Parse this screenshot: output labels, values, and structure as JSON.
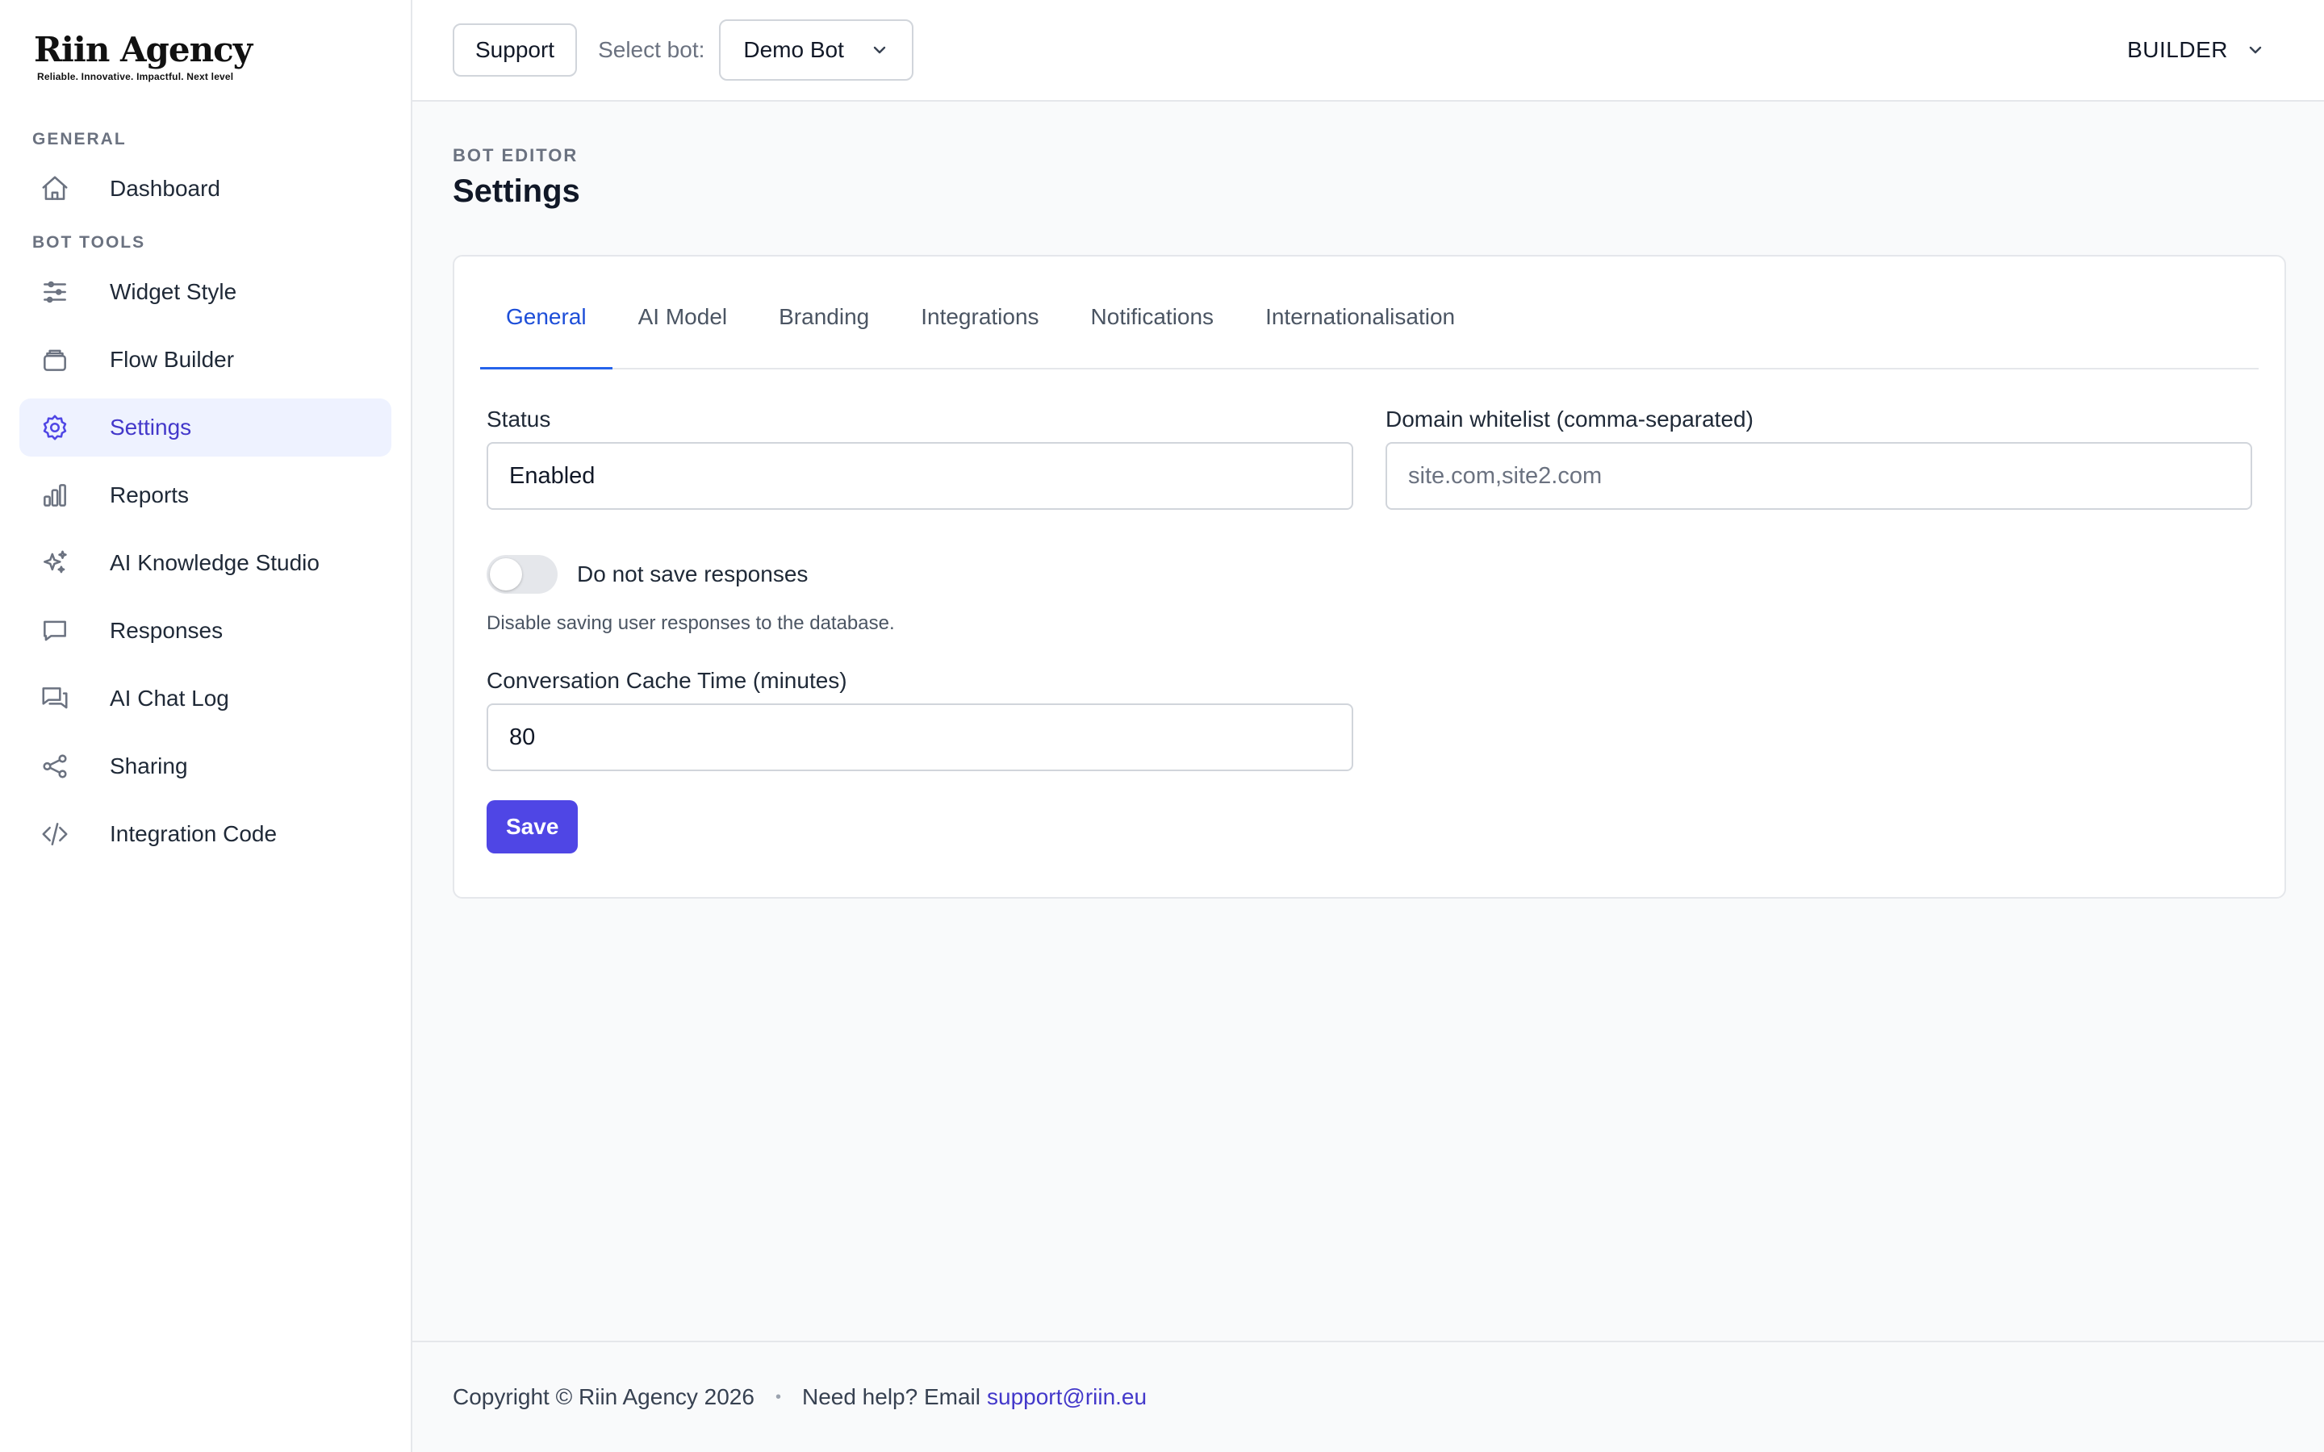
{
  "brand": {
    "name": "Riin Agency",
    "tagline": "Reliable. Innovative. Impactful. Next level"
  },
  "sidebar": {
    "sections": [
      {
        "label": "GENERAL"
      },
      {
        "label": "BOT TOOLS"
      }
    ],
    "items": [
      {
        "label": "Dashboard",
        "icon": "home-icon"
      },
      {
        "label": "Widget Style",
        "icon": "sliders-icon"
      },
      {
        "label": "Flow Builder",
        "icon": "stack-icon"
      },
      {
        "label": "Settings",
        "icon": "gear-icon",
        "active": true
      },
      {
        "label": "Reports",
        "icon": "bar-chart-icon"
      },
      {
        "label": "AI Knowledge Studio",
        "icon": "sparkles-icon"
      },
      {
        "label": "Responses",
        "icon": "chat-bubble-icon"
      },
      {
        "label": "AI Chat Log",
        "icon": "chat-bubbles-icon"
      },
      {
        "label": "Sharing",
        "icon": "share-icon"
      },
      {
        "label": "Integration Code",
        "icon": "code-icon"
      }
    ]
  },
  "topbar": {
    "support_label": "Support",
    "select_bot_label": "Select bot:",
    "selected_bot": "Demo Bot",
    "user_menu_label": "BUILDER"
  },
  "page": {
    "eyebrow": "BOT EDITOR",
    "title": "Settings"
  },
  "tabs": [
    {
      "label": "General",
      "active": true
    },
    {
      "label": "AI Model"
    },
    {
      "label": "Branding"
    },
    {
      "label": "Integrations"
    },
    {
      "label": "Notifications"
    },
    {
      "label": "Internationalisation"
    }
  ],
  "form": {
    "status_label": "Status",
    "status_value": "Enabled",
    "domain_label": "Domain whitelist (comma-separated)",
    "domain_value": "",
    "domain_placeholder": "site.com,site2.com",
    "toggle_label": "Do not save responses",
    "toggle_on": false,
    "toggle_help": "Disable saving user responses to the database.",
    "cache_label": "Conversation Cache Time (minutes)",
    "cache_value": "80",
    "save_label": "Save"
  },
  "footer": {
    "copyright": "Copyright © Riin Agency 2026",
    "separator": "•",
    "help_text": "Need help? Email",
    "email": "support@riin.eu"
  },
  "colors": {
    "accent": "#4f46e5",
    "active_bg": "#eef2ff",
    "tab_active": "#2563eb"
  }
}
